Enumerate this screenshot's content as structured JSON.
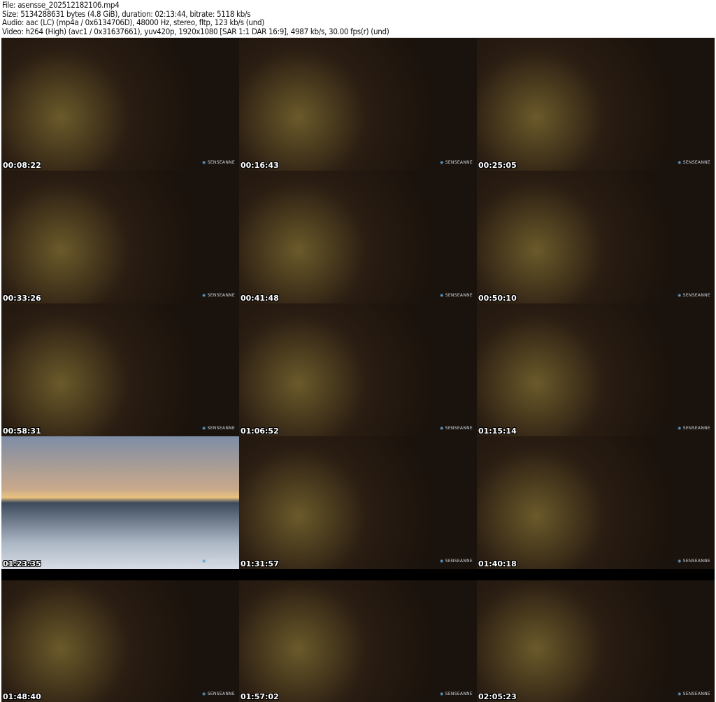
{
  "header": {
    "file": "File: asensse_202512182106.mp4",
    "size": "Size: 5134288631 bytes (4.8 GiB), duration: 02:13:44, bitrate: 5118 kb/s",
    "audio": "Audio: aac (LC) (mp4a / 0x6134706D), 48000 Hz, stereo, fltp, 123 kb/s (und)",
    "video": "Video: h264 (High) (avc1 / 0x31637661), yuv420p, 1920x1080 [SAR 1:1 DAR 16:9], 4987 kb/s, 30.00 fps(r) (und)"
  },
  "watermark": "SENSEANNE",
  "thumbnails": [
    {
      "time": "00:08:22"
    },
    {
      "time": "00:16:43"
    },
    {
      "time": "00:25:05"
    },
    {
      "time": "00:33:26"
    },
    {
      "time": "00:41:48"
    },
    {
      "time": "00:50:10"
    },
    {
      "time": "00:58:31"
    },
    {
      "time": "01:06:52"
    },
    {
      "time": "01:15:14"
    },
    {
      "time": "01:23:35",
      "scene": "beach"
    },
    {
      "time": "01:31:57"
    },
    {
      "time": "01:40:18"
    },
    {
      "time": "01:48:40",
      "scene": "letterbox"
    },
    {
      "time": "01:57:02",
      "scene": "letterbox"
    },
    {
      "time": "02:05:23",
      "scene": "letterbox"
    }
  ]
}
